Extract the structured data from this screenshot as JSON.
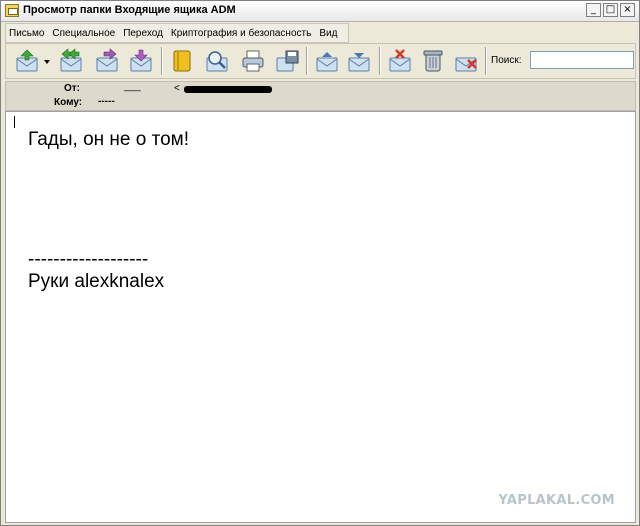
{
  "window": {
    "title": "Просмотр папки Входящие ящика ADM",
    "controls": [
      "_",
      "□",
      "×"
    ]
  },
  "menu": [
    "Письмо",
    "Специальное",
    "Переход",
    "Криптография и безопасность",
    "Вид"
  ],
  "toolbar": {
    "buttons": [
      "receive-icon",
      "dropdown-arrow-icon",
      "reply-all-icon",
      "forward-icon",
      "send-icon",
      "address-book-icon",
      "search-mail-icon",
      "print-icon",
      "save-icon",
      "move-up-icon",
      "move-down-icon",
      "delete-mark-icon",
      "trash-icon",
      "delete-icon"
    ],
    "search_label": "Поиск:",
    "search_value": ""
  },
  "header": {
    "from_label": "От:",
    "from_value": "___",
    "from_addr_prefix": "<",
    "to_label": "Кому:",
    "to_value": "-----"
  },
  "message": {
    "line1": "Гады, он не о том!",
    "separator": "-------------------",
    "signature": "Руки alexknalex"
  },
  "watermark": "YAPLAKAL.COM",
  "colors": {
    "chrome": "#ece9d8",
    "header_bg": "#ddd9cc",
    "body_bg": "#ffffff",
    "watermark": "#b8c4cc"
  }
}
